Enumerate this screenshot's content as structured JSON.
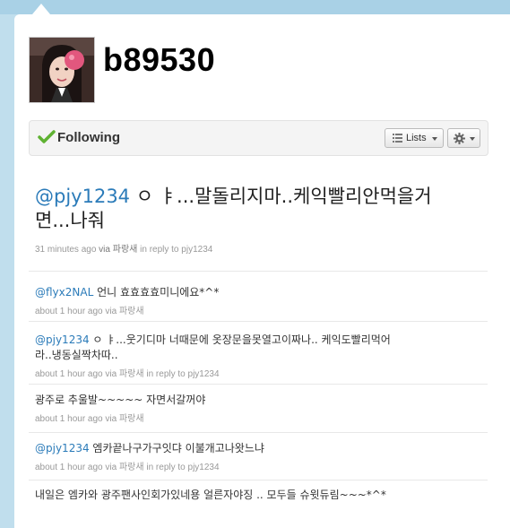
{
  "profile": {
    "username": "b89530"
  },
  "follow": {
    "status_label": "Following",
    "lists_label": "Lists"
  },
  "main_tweet": {
    "mention": "@pjy1234",
    "text": " ㅇ ㅑ...말돌리지마..케익빨리안먹을거면...나줘",
    "time": "31 minutes ago",
    "via_prefix": "via",
    "client": "파랑새",
    "reply_prefix": "in reply to",
    "reply_to": "pjy1234"
  },
  "tweets": [
    {
      "mention": "@flyx2NAL",
      "text": " 언니 효효효효미니에요*^*",
      "time": "about 1 hour ago",
      "via_prefix": "via",
      "client": "파랑새",
      "reply_prefix": "",
      "reply_to": ""
    },
    {
      "mention": "@pjy1234",
      "text": " ㅇ ㅑ...웃기디마 너때문에 옷장문을못열고이짜나.. 케익도빨리먹어라..냉동실짝차따..",
      "time": "about 1 hour ago",
      "via_prefix": "via",
      "client": "파랑새",
      "reply_prefix": "in reply to",
      "reply_to": "pjy1234"
    },
    {
      "mention": "",
      "text": "광주로 추울발~~~~~ 자면서갈꺼야",
      "time": "about 1 hour ago",
      "via_prefix": "via",
      "client": "파랑새",
      "reply_prefix": "",
      "reply_to": ""
    },
    {
      "mention": "@pjy1234",
      "text": " 엠카끝나구가구잇댜 이불개고나왓느냐",
      "time": "about 1 hour ago",
      "via_prefix": "via",
      "client": "파랑새",
      "reply_prefix": "in reply to",
      "reply_to": "pjy1234"
    },
    {
      "mention": "",
      "text": "내일은 엠카와 광주팬사인회가있네용 얼른자야징 .. 모두들 슈윗듀림~~~*^*",
      "time": "",
      "via_prefix": "",
      "client": "",
      "reply_prefix": "",
      "reply_to": ""
    }
  ],
  "colors": {
    "link": "#2b7bb9",
    "background": "#c0deed",
    "check": "#5fb232"
  },
  "icons": {
    "follow_status": "check-icon",
    "lists": "list-icon",
    "settings": "gear-icon",
    "dropdown": "chevron-down-icon"
  }
}
